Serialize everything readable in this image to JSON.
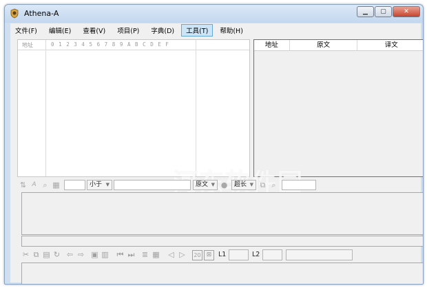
{
  "window": {
    "title": "Athena-A"
  },
  "menu": [
    {
      "label": "文件(F)",
      "active": false
    },
    {
      "label": "编辑(E)",
      "active": false
    },
    {
      "label": "查看(V)",
      "active": false
    },
    {
      "label": "项目(P)",
      "active": false
    },
    {
      "label": "字典(D)",
      "active": false
    },
    {
      "label": "工具(T)",
      "active": true
    },
    {
      "label": "帮助(H)",
      "active": false
    }
  ],
  "hex": {
    "address_header": "地址",
    "columns": [
      "0",
      "1",
      "2",
      "3",
      "4",
      "5",
      "6",
      "7",
      "8",
      "9",
      "A",
      "B",
      "C",
      "D",
      "E",
      "F"
    ]
  },
  "table": {
    "headers": [
      "地址",
      "原文",
      "译文"
    ]
  },
  "search_toolbar": {
    "compare_select": "小于",
    "text_select": "原文",
    "length_select": "超长"
  },
  "edit_toolbar": {
    "btn_20": "20",
    "l1_label": "L1",
    "l2_label": "L2"
  },
  "watermark": "河东软件园"
}
